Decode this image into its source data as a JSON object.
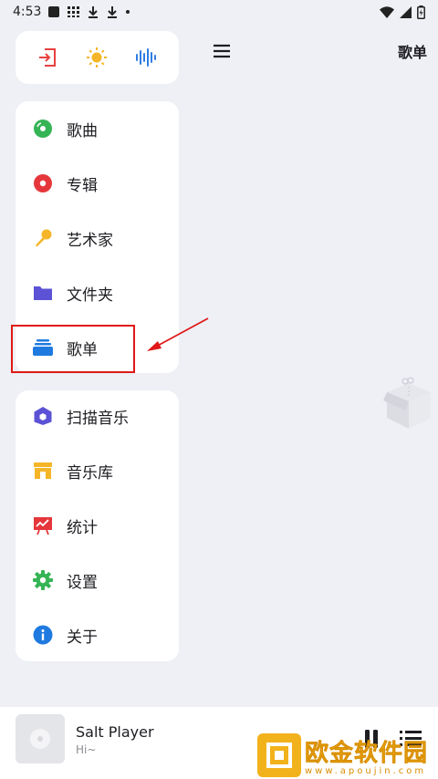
{
  "status_bar": {
    "time": "4:53"
  },
  "header": {
    "title": "歌单"
  },
  "quick_actions": [
    {
      "icon": "exit-icon",
      "color": "#e8413f"
    },
    {
      "icon": "sun-icon",
      "color": "#f4b528"
    },
    {
      "icon": "waveform-icon",
      "color": "#2f7de1"
    }
  ],
  "nav": {
    "library_items": [
      {
        "label": "歌曲",
        "icon": "songs-disc-icon",
        "color": "#35b455"
      },
      {
        "label": "专辑",
        "icon": "album-icon",
        "color": "#e5373b"
      },
      {
        "label": "艺术家",
        "icon": "microphone-icon",
        "color": "#f4b528"
      },
      {
        "label": "文件夹",
        "icon": "folder-icon",
        "color": "#5b52d6"
      },
      {
        "label": "歌单",
        "icon": "playlist-icon",
        "color": "#1f7ae0"
      }
    ],
    "tool_items": [
      {
        "label": "扫描音乐",
        "icon": "scan-icon",
        "color": "#5b52d6"
      },
      {
        "label": "音乐库",
        "icon": "store-icon",
        "color": "#f4b528"
      },
      {
        "label": "统计",
        "icon": "chart-icon",
        "color": "#e5373b"
      },
      {
        "label": "设置",
        "icon": "gear-icon",
        "color": "#35b455"
      },
      {
        "label": "关于",
        "icon": "info-icon",
        "color": "#1f7ae0"
      }
    ]
  },
  "player": {
    "title": "Salt Player",
    "subtitle": "Hi~"
  },
  "watermark": {
    "text": "欧金软件园",
    "url": "www.apoujin.com"
  },
  "annotation": {
    "highlight_color": "#e01818"
  }
}
